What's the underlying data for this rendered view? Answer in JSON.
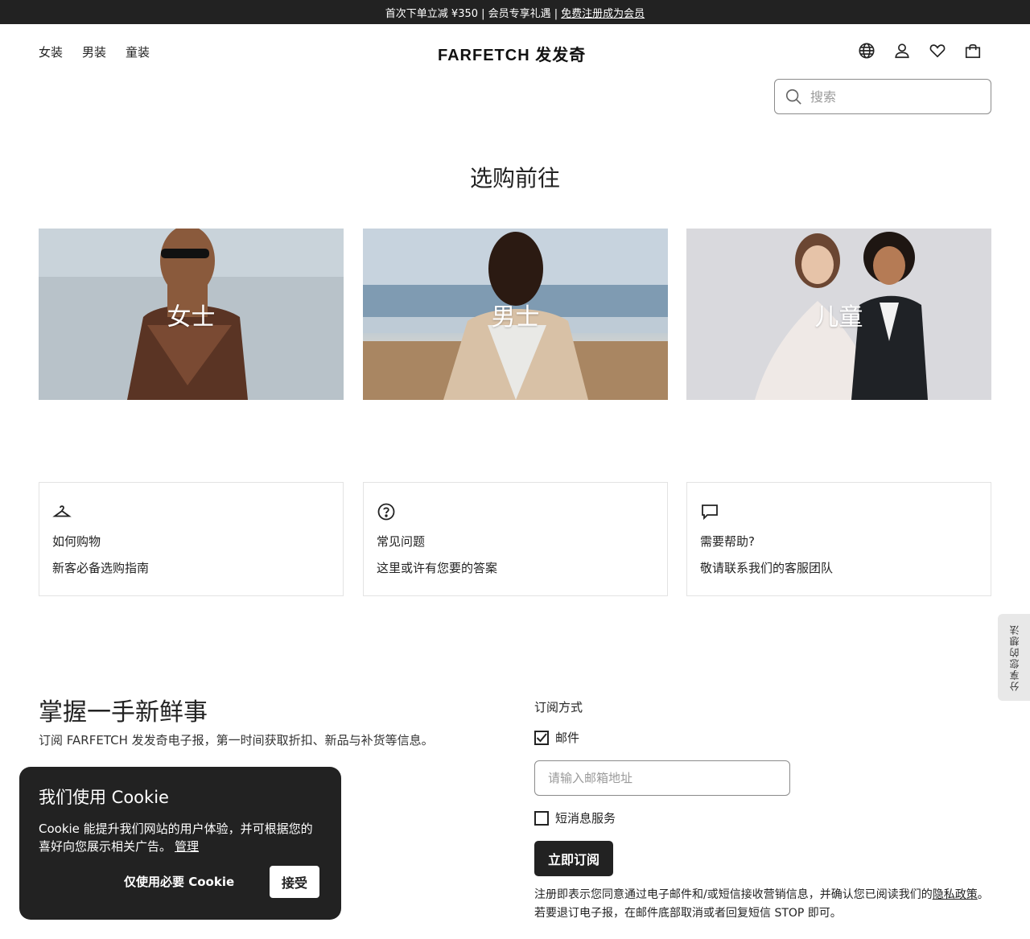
{
  "promo": {
    "text": "首次下单立减 ¥350 | 会员专享礼遇 |",
    "link": "免费注册成为会员"
  },
  "nav": {
    "women": "女装",
    "men": "男装",
    "kids": "童装"
  },
  "logo": {
    "text": "FARFETCH 发发奇"
  },
  "header_icons": [
    "globe-icon",
    "account-icon",
    "wishlist-heart-icon",
    "shopping-bag-icon"
  ],
  "search": {
    "placeholder": "搜索"
  },
  "shop_section": {
    "title": "选购前往",
    "categories": [
      {
        "label": "女士"
      },
      {
        "label": "男士"
      },
      {
        "label": "儿童"
      }
    ]
  },
  "help_cards": [
    {
      "icon": "hanger-icon",
      "title": "如何购物",
      "subtitle": "新客必备选购指南"
    },
    {
      "icon": "question-circle-icon",
      "title": "常见问题",
      "subtitle": "这里或许有您要的答案"
    },
    {
      "icon": "chat-bubble-icon",
      "title": "需要帮助?",
      "subtitle": "敬请联系我们的客服团队"
    }
  ],
  "feedback": {
    "label": "分享您的想法"
  },
  "newsletter": {
    "title": "掌握一手新鲜事",
    "subtitle": "订阅 FARFETCH 发发奇电子报，第一时间获取折扣、新品与补货等信息。",
    "method_label": "订阅方式",
    "email_option": "邮件",
    "email_checked": true,
    "email_placeholder": "请输入邮箱地址",
    "sms_option": "短消息服务",
    "sms_checked": false,
    "subscribe_button": "立即订阅",
    "legal_prefix": "注册即表示您同意通过电子邮件和/或短信接收营销信息，并确认您已阅读我们的",
    "legal_link": "隐私政策",
    "legal_suffix": "。 若要退订电子报，在邮件底部取消或者回复短信 STOP 即可。"
  },
  "cookie": {
    "title": "我们使用 Cookie",
    "body": "Cookie 能提升我们网站的用户体验，并可根据您的喜好向您展示相关广告。",
    "manage": "管理",
    "essential_button": "仅使用必要 Cookie",
    "accept_button": "接受"
  }
}
